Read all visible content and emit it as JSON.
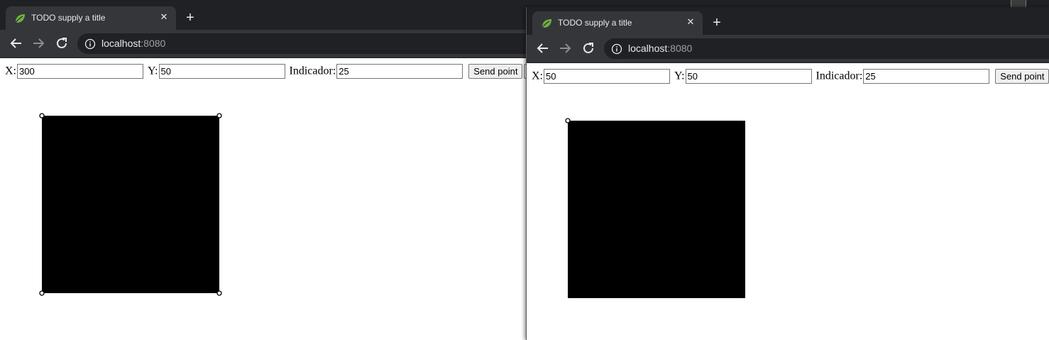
{
  "windows": [
    {
      "tab_title": "TODO supply a title",
      "url_host": "localhost",
      "url_port": ":8080",
      "form": {
        "x_label": "X:",
        "x_value": "300",
        "y_label": "Y:",
        "y_value": "50",
        "indicator_label": "Indicador:",
        "indicator_value": "25",
        "send_label": "Send point"
      }
    },
    {
      "tab_title": "TODO supply a title",
      "url_host": "localhost",
      "url_port": ":8080",
      "form": {
        "x_label": "X:",
        "x_value": "50",
        "y_label": "Y:",
        "y_value": "50",
        "indicator_label": "Indicador:",
        "indicator_value": "25",
        "send_label": "Send point"
      }
    }
  ],
  "colors": {
    "tabbar": "#202124",
    "tab_active": "#35363a",
    "square_fill": "#000000",
    "page_bg": "#ffffff"
  },
  "icons": [
    "leaf-icon",
    "close-icon",
    "plus-icon",
    "back-arrow-icon",
    "forward-arrow-icon",
    "reload-icon",
    "info-icon"
  ]
}
